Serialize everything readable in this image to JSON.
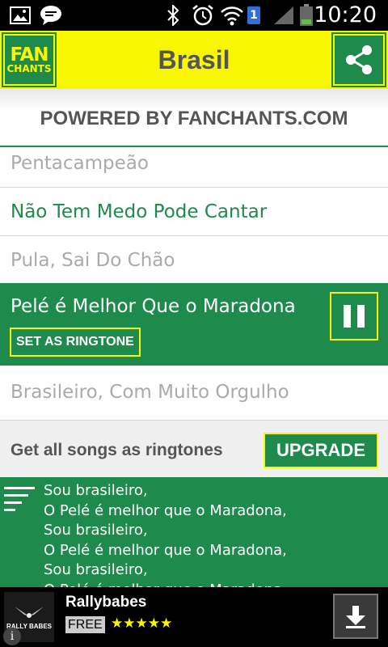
{
  "status_bar": {
    "time": "10:20",
    "sim_badge": "1",
    "icons": [
      "image-icon",
      "chat-icon",
      "bluetooth-icon",
      "alarm-icon",
      "wifi-icon",
      "sim-icon",
      "signal-icon",
      "battery-icon"
    ]
  },
  "header": {
    "logo_line1": "FAN",
    "logo_line2": "CHANTS",
    "title": "Brasil",
    "share_icon": "share-icon"
  },
  "powered_by": "POWERED BY FANCHANTS.COM",
  "songs": [
    {
      "title": "Pentacampeão",
      "style": "dim"
    },
    {
      "title": "Não Tem Medo Pode Cantar",
      "style": "green"
    },
    {
      "title": "Pula, Sai Do Chão",
      "style": "dim"
    },
    {
      "title": "Pelé é Melhor Que o Maradona",
      "style": "active"
    },
    {
      "title": "Brasileiro, Com Muito Orgulho",
      "style": "dim"
    }
  ],
  "active_song": {
    "ringtone_label": "SET AS RINGTONE",
    "control_icon": "pause-icon"
  },
  "upgrade": {
    "text": "Get all songs as ringtones",
    "button_label": "UPGRADE"
  },
  "lyrics": {
    "icon": "lyrics-icon",
    "lines": [
      "Sou brasileiro,",
      "O Pelé é melhor que o Maradona,",
      "Sou brasileiro,",
      "O Pelé é melhor que o Maradona,",
      "Sou brasileiro,",
      "O Pelé é melhor que o Maradona,"
    ]
  },
  "ad": {
    "logo_text": "RALLY BABES",
    "app_name": "Rallybabes",
    "price": "FREE",
    "stars": "★★★★★",
    "rating": 5,
    "download_icon": "download-icon",
    "info_icon": "info-icon"
  },
  "colors": {
    "brand_green": "#1e8a4c",
    "brand_yellow": "#f8f600",
    "dim_text": "#aaaaaa"
  }
}
